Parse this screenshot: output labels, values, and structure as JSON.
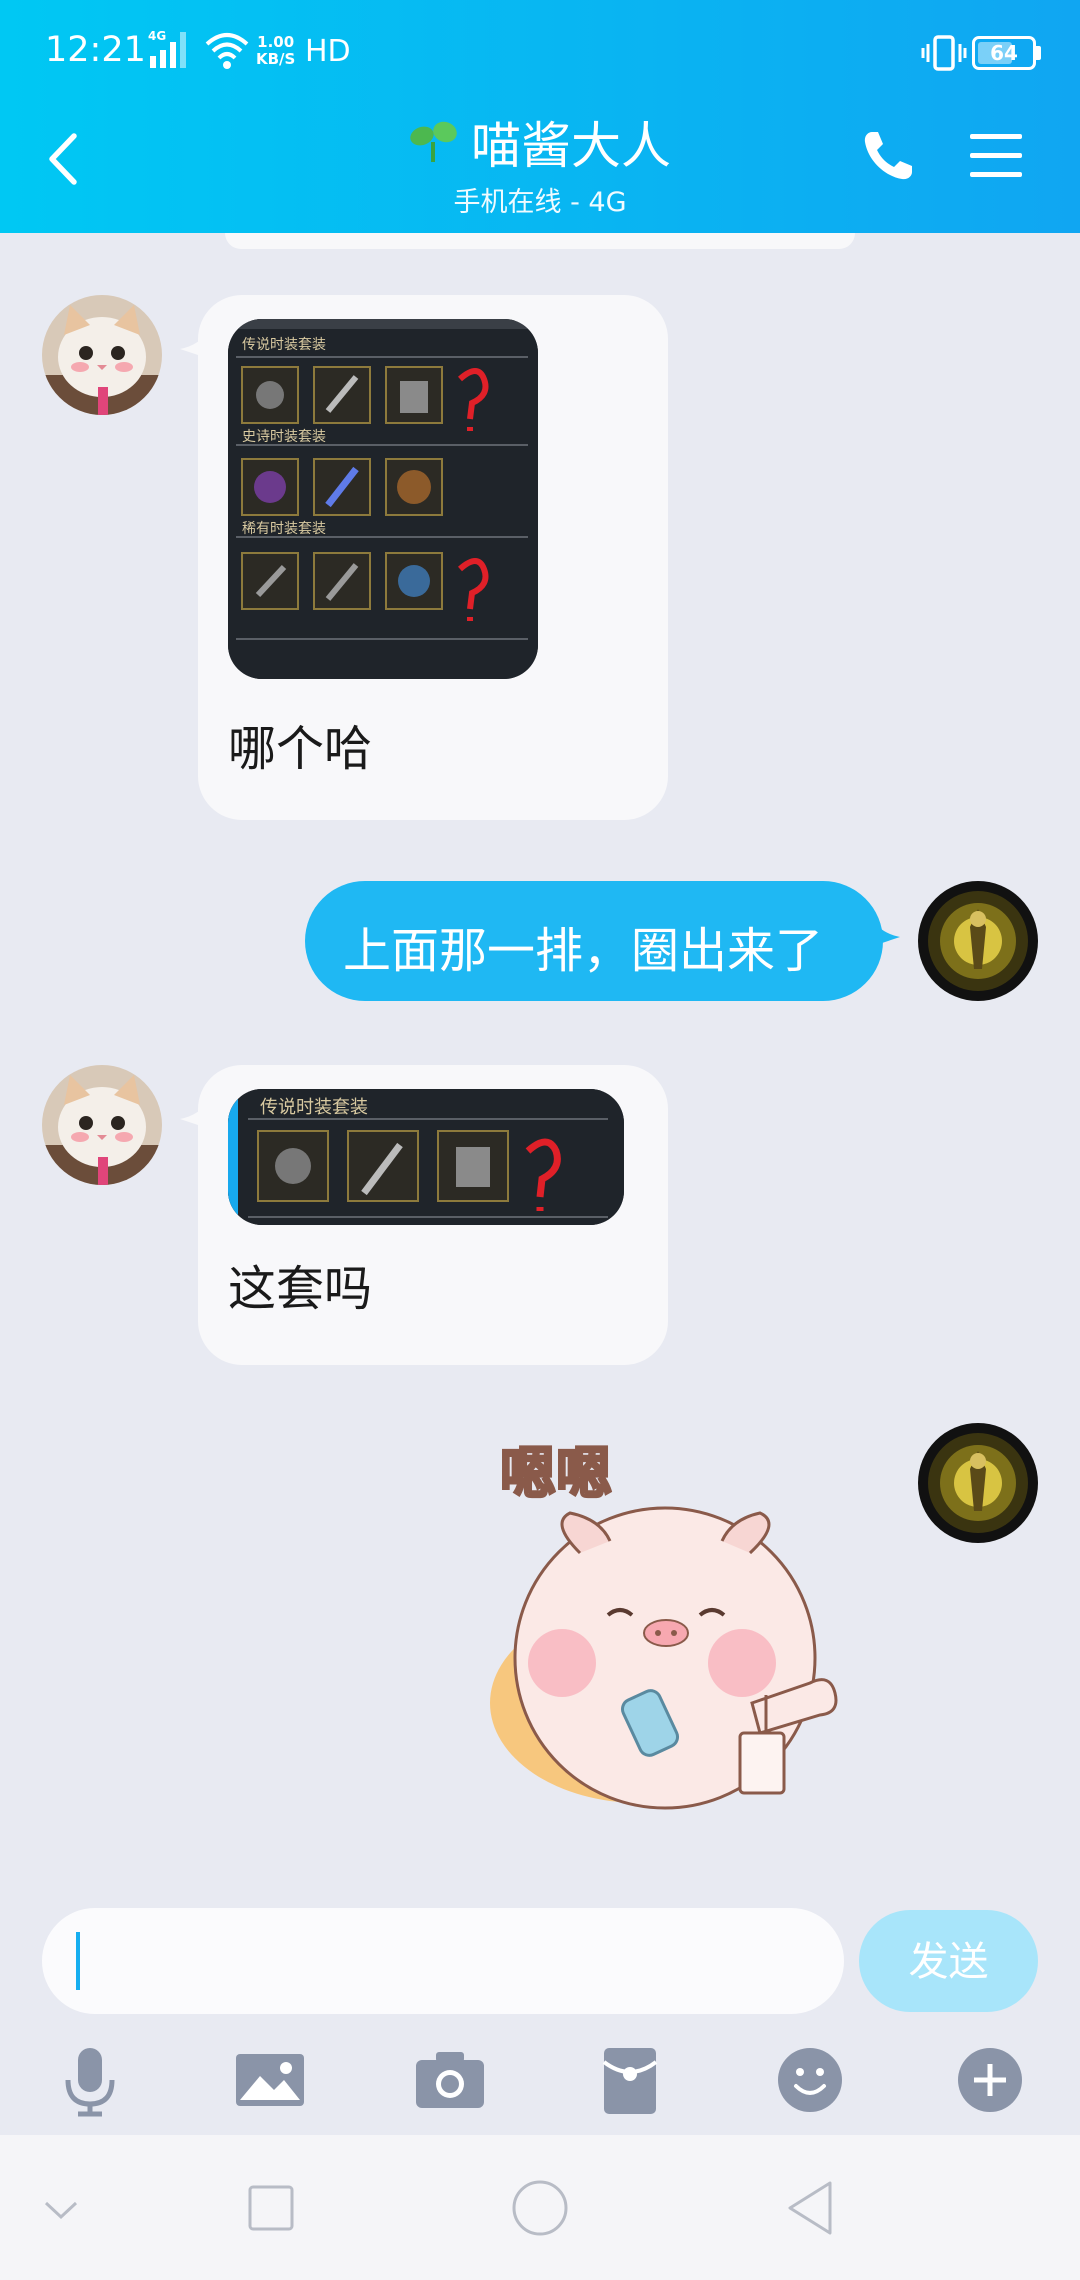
{
  "status_bar": {
    "time": "12:21",
    "network": "4G",
    "speed_value": "1.00",
    "speed_unit": "KB/S",
    "hd": "HD",
    "battery": "64"
  },
  "header": {
    "title": "喵酱大人",
    "subtitle": "手机在线 - 4G",
    "accent_color": "#10a6f2"
  },
  "messages": [
    {
      "side": "in",
      "image_icon": "game-costume-screenshot",
      "text": "哪个哈",
      "image_labels": [
        "传说时装套装",
        "史诗时装套装",
        "稀有时装套装"
      ]
    },
    {
      "side": "out",
      "text": "上面那一排，圈出来了"
    },
    {
      "side": "in",
      "image_icon": "game-costume-crop",
      "text": "这套吗",
      "image_labels": [
        "传说时装套装"
      ]
    },
    {
      "side": "out",
      "sticker_icon": "pig-sticker",
      "sticker_text": "嗯嗯"
    }
  ],
  "input": {
    "value": "",
    "send_label": "发送"
  },
  "toolbar": [
    "microphone-icon",
    "image-icon",
    "camera-icon",
    "red-packet-icon",
    "emoji-icon",
    "plus-icon"
  ],
  "nav": [
    "collapse-icon",
    "recents-icon",
    "home-icon",
    "back-nav-icon"
  ]
}
